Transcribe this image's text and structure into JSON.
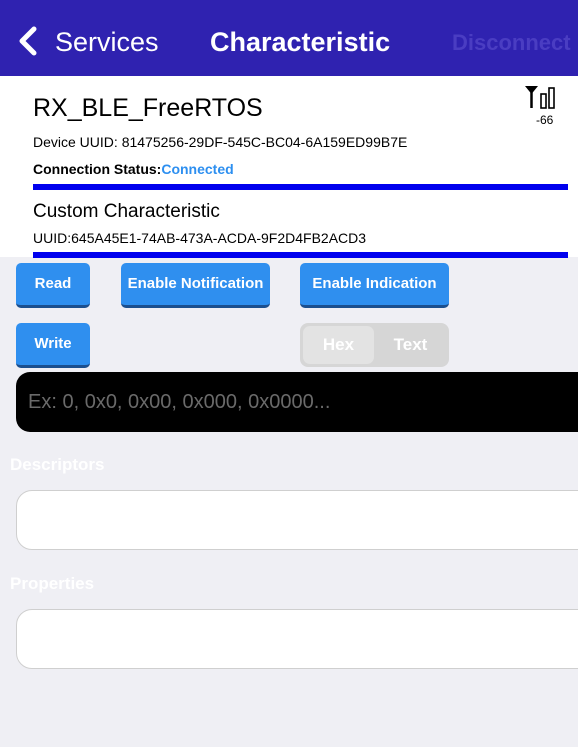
{
  "nav": {
    "back_label": "Services",
    "title": "Characteristic",
    "right_label": "Disconnect"
  },
  "device": {
    "name": "RX_BLE_FreeRTOS",
    "rssi": "-66",
    "uuid_label": "Device UUID:",
    "uuid_value": "81475256-29DF-545C-BC04-6A159ED99B7E",
    "status_label": "Connection Status:",
    "status_value": "Connected"
  },
  "characteristic": {
    "name": "Custom Characteristic",
    "uuid_label": "UUID:",
    "uuid_value": "645A45E1-74AB-473A-ACDA-9F2D4FB2ACD3"
  },
  "actions": {
    "read_label": "Read",
    "notify_label": "Enable Notification",
    "indicate_label": "Enable Indication",
    "write_label": "Write"
  },
  "format_toggle": {
    "options": [
      "Hex",
      "Text"
    ],
    "selected": "Hex"
  },
  "write_input": {
    "placeholder": "Ex: 0, 0x0, 0x00, 0x000, 0x0000...",
    "value": ""
  },
  "sections": {
    "descriptors_label": "Descriptors",
    "properties_label": "Properties"
  },
  "colors": {
    "nav_background": "#2f22b0",
    "button_blue": "#2f8fef",
    "connected_blue": "#2d8ff0",
    "divider_blue": "#0000ee",
    "page_background": "#efeff4"
  },
  "icons": {
    "back": "chevron-left-icon",
    "signal": "signal-strength-icon"
  }
}
